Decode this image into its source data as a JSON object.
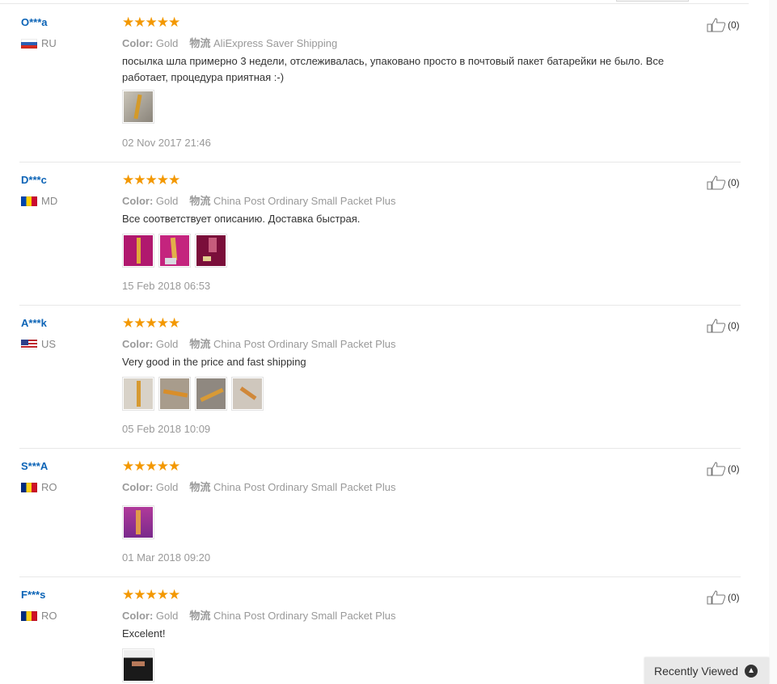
{
  "common": {
    "color_label": "Color:",
    "shipping_label": "物流"
  },
  "reviews": [
    {
      "user": "O***a",
      "country": "RU",
      "color": "Gold",
      "shipping": "AliExpress Saver Shipping",
      "text": "посылка шла примерно 3 недели, отслеживалась, упаковано просто в почтовый пакет батарейки не было. Все работает, процедура приятная :-)",
      "date": "02 Nov 2017 21:46",
      "likes": "(0)",
      "rating": 5
    },
    {
      "user": "D***c",
      "country": "MD",
      "color": "Gold",
      "shipping": "China Post Ordinary Small Packet Plus",
      "text": "Все соответствует описанию. Доставка быстрая.",
      "date": "15 Feb 2018 06:53",
      "likes": "(0)",
      "rating": 5
    },
    {
      "user": "A***k",
      "country": "US",
      "color": "Gold",
      "shipping": "China Post Ordinary Small Packet Plus",
      "text": "Very good in the price and fast shipping",
      "date": "05 Feb 2018 10:09",
      "likes": "(0)",
      "rating": 5
    },
    {
      "user": "S***A",
      "country": "RO",
      "color": "Gold",
      "shipping": "China Post Ordinary Small Packet Plus",
      "text": "",
      "date": "01 Mar 2018 09:20",
      "likes": "(0)",
      "rating": 5
    },
    {
      "user": "F***s",
      "country": "RO",
      "color": "Gold",
      "shipping": "China Post Ordinary Small Packet Plus",
      "text": "Excelent!",
      "date": "",
      "likes": "(0)",
      "rating": 5
    }
  ],
  "recently_viewed": "Recently Viewed",
  "stars_glyph": "★★★★★",
  "colors": {
    "user_link": "#0b63b6",
    "star": "#f39800",
    "muted": "#999999"
  }
}
